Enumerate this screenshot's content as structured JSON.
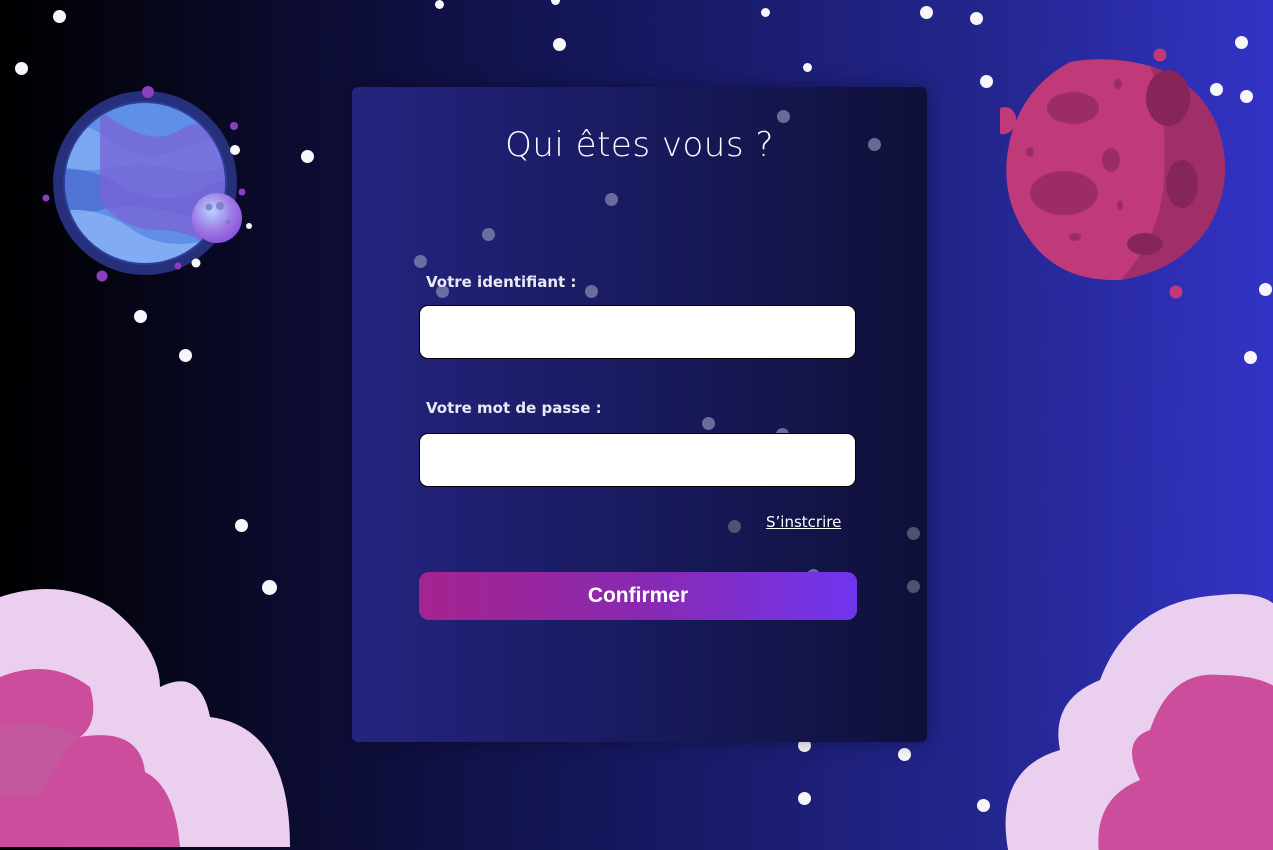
{
  "login": {
    "title": "Qui êtes vous ?",
    "username_label": "Votre identifiant :",
    "username_value": "",
    "password_label": "Votre mot de passe :",
    "password_value": "",
    "signup_link": "S’instcrire",
    "confirm_button": "Confirmer"
  },
  "colors": {
    "background_left": "#000000",
    "background_right": "#3333c6",
    "card": "#1a1b62",
    "button_start": "#a5248e",
    "button_end": "#6f35ee",
    "asteroid": "#c03a7a",
    "cloud_light": "#ead0ee",
    "cloud_pink": "#cc4d9b"
  },
  "icons": {
    "planet": "blue-striped-planet-with-moon",
    "asteroid": "pink-cratered-asteroid",
    "clouds": "pink-clouds"
  }
}
